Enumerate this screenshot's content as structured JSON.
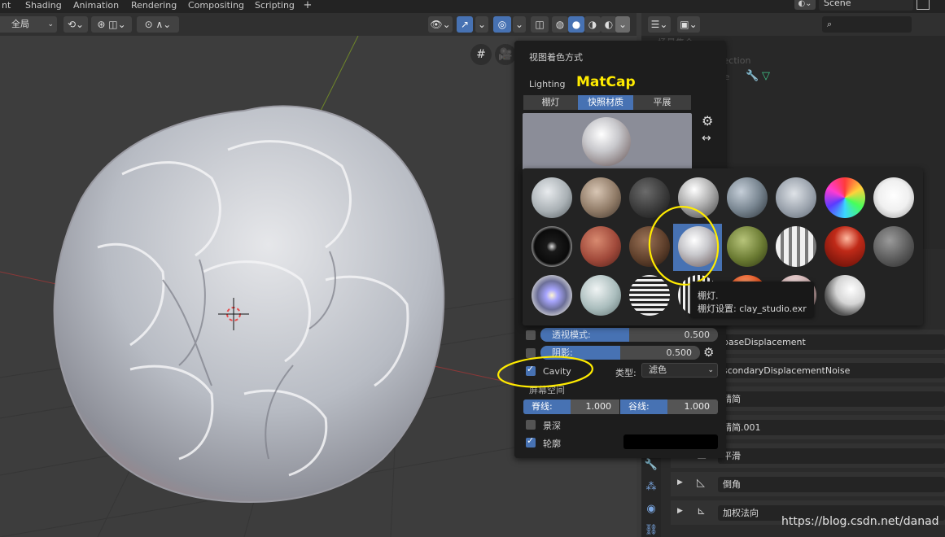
{
  "workspace_tabs": [
    "nt",
    "Shading",
    "Animation",
    "Rendering",
    "Compositing",
    "Scripting"
  ],
  "workspace_add": "+",
  "scene": {
    "name": "Scene"
  },
  "viewport_header": {
    "orientation_select": "全局",
    "chevron": "⌄"
  },
  "shading_popover": {
    "title": "视图着色方式",
    "lighting_label": "Lighting",
    "annotation": "MatCap",
    "lighting_options": [
      "棚灯",
      "快照材质",
      "平展"
    ],
    "active_lighting": "快照材质",
    "xray": {
      "label": "透视模式:",
      "value": "0.500",
      "fraction": 0.5
    },
    "shadow": {
      "label": "阴影:",
      "value": "0.500",
      "fraction": 0.5
    },
    "cavity": {
      "label": "Cavity",
      "checked": true,
      "type_label": "类型:",
      "type_value": "滤色"
    },
    "screen_space_label": "屏幕空间",
    "ridge": {
      "label": "脊线:",
      "value": "1.000"
    },
    "valley": {
      "label": "谷线:",
      "value": "1.000"
    },
    "depth_of_field": {
      "label": "景深",
      "checked": false
    },
    "outline": {
      "label": "轮廓",
      "checked": true,
      "color": "#000000"
    }
  },
  "matcap_tooltip": {
    "line1": "棚灯.",
    "line2": "棚灯设置: clay_studio.exr"
  },
  "outliner": {
    "items": [
      "场景集合",
      "Collection",
      "Cube"
    ]
  },
  "modifiers": [
    "baseDisplacement",
    "scondaryDisplacementNoise",
    "精简",
    "精简.001",
    "平滑",
    "倒角",
    "加权法向"
  ],
  "watermark": "https://blog.csdn.net/danad",
  "colors": {
    "accent": "#4772b3",
    "annotation": "#ffeb00",
    "popover_bg": "#1d1d1d"
  }
}
